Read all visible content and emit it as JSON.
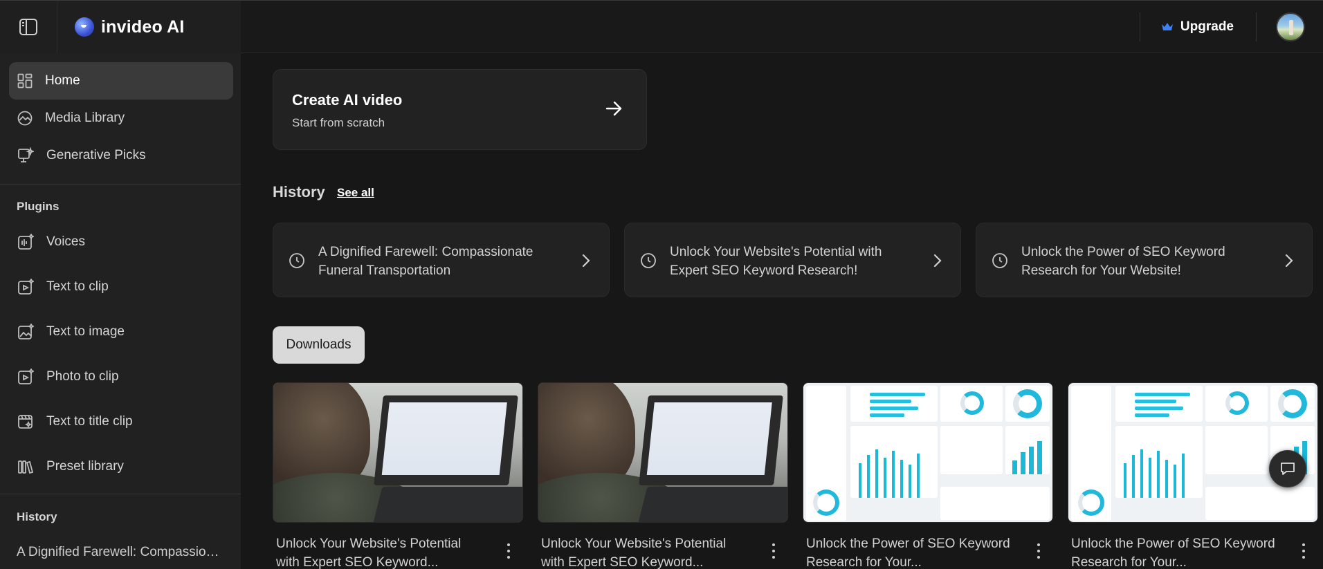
{
  "brand": {
    "name": "invideo AI"
  },
  "header": {
    "upgrade_label": "Upgrade"
  },
  "sidebar": {
    "nav": [
      {
        "label": "Home",
        "icon": "grid-icon",
        "active": true
      },
      {
        "label": "Media Library",
        "icon": "image-icon"
      },
      {
        "label": "Generative Picks",
        "icon": "generative-icon"
      }
    ],
    "plugins_heading": "Plugins",
    "plugins": [
      {
        "label": "Voices",
        "icon": "voice-icon"
      },
      {
        "label": "Text to clip",
        "icon": "text-to-clip-icon"
      },
      {
        "label": "Text to image",
        "icon": "text-to-image-icon"
      },
      {
        "label": "Photo to clip",
        "icon": "photo-to-clip-icon"
      },
      {
        "label": "Text to title clip",
        "icon": "title-clip-icon"
      },
      {
        "label": "Preset library",
        "icon": "library-icon"
      }
    ],
    "history_heading": "History",
    "history_items": [
      "A Dignified Farewell: Compassionate Funeral Transportation"
    ]
  },
  "main": {
    "create": {
      "title": "Create AI video",
      "subtitle": "Start from scratch"
    },
    "history": {
      "title": "History",
      "see_all": "See all",
      "items": [
        "A Dignified Farewell: Compassionate Funeral Transportation",
        "Unlock Your Website's Potential with Expert SEO Keyword Research!",
        "Unlock the Power of SEO Keyword Research for Your Website!"
      ]
    },
    "downloads_label": "Downloads",
    "downloads": [
      {
        "title": "Unlock Your Website's Potential with Expert SEO Keyword...",
        "thumb": "photo"
      },
      {
        "title": "Unlock Your Website's Potential with Expert SEO Keyword...",
        "thumb": "photo"
      },
      {
        "title": "Unlock the Power of SEO Keyword Research for Your...",
        "thumb": "dashboard"
      },
      {
        "title": "Unlock the Power of SEO Keyword Research for Your...",
        "thumb": "dashboard"
      }
    ]
  },
  "colors": {
    "accent_upgrade": "#3b82f6",
    "chart": "#1cb8d8"
  }
}
